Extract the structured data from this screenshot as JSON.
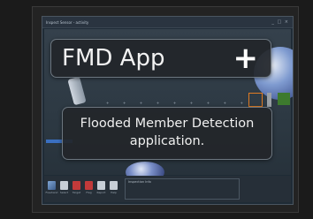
{
  "window": {
    "title": "Inspect Sensor - activity",
    "controls": "_ □ ×"
  },
  "fmd_card": {
    "title": "FMD App",
    "add_icon": "+"
  },
  "description": {
    "line1": "Flooded Member Detection",
    "line2": "application."
  },
  "ruler": {
    "ticks": [
      "+",
      "+",
      "+",
      "+",
      "+",
      "+",
      "+",
      "+",
      "+"
    ]
  },
  "toolbar": {
    "items": [
      {
        "icon": "pen-icon",
        "label": "Freehand"
      },
      {
        "icon": "select-icon",
        "label": "Select"
      },
      {
        "icon": "target-icon",
        "label": "Target"
      },
      {
        "icon": "flag-icon",
        "label": "Flag"
      },
      {
        "icon": "document-icon",
        "label": "Report"
      },
      {
        "icon": "help-icon",
        "label": "Help"
      }
    ],
    "panel_label": "Inspection Info"
  }
}
